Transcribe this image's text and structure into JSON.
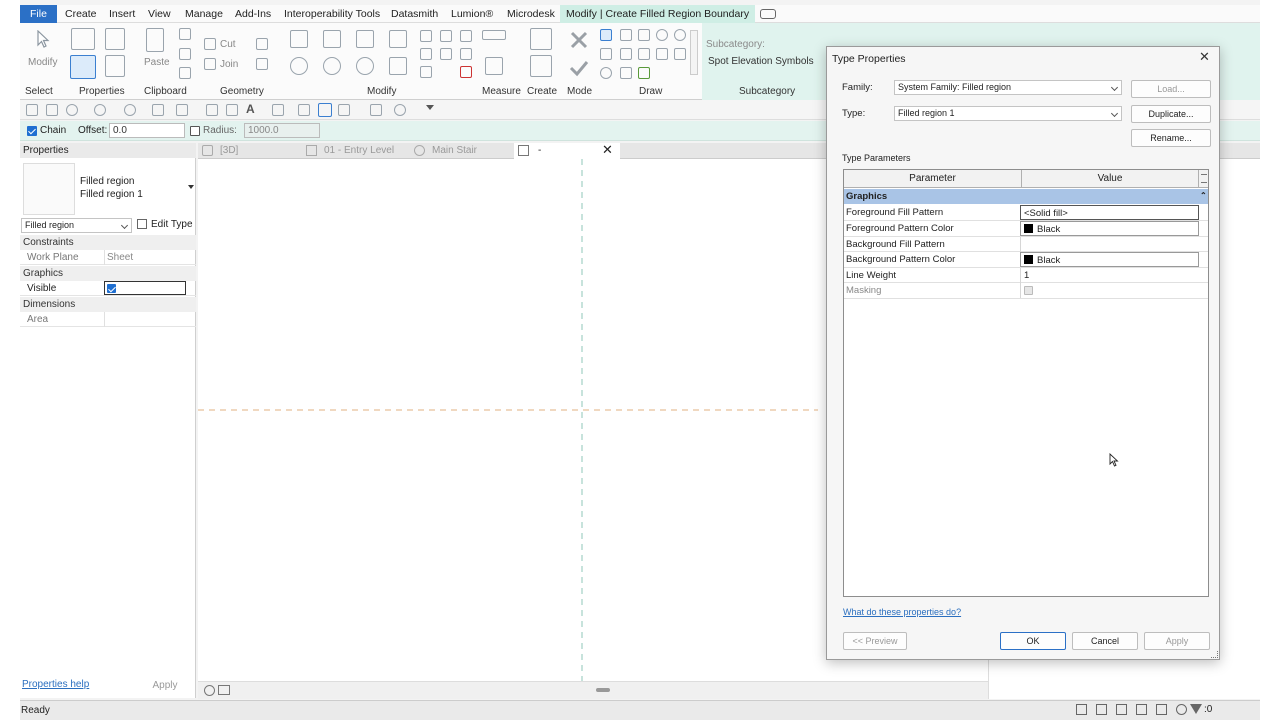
{
  "menu": {
    "tabs": [
      "File",
      "Create",
      "Insert",
      "View",
      "Manage",
      "Add-Ins",
      "Interoperability Tools",
      "Datasmith",
      "Lumion®",
      "Microdesk",
      "Modify | Create Filled Region Boundary"
    ]
  },
  "ribbon": {
    "modify_label": "Modify",
    "paste_label": "Paste",
    "cut_label": "Cut",
    "join_label": "Join",
    "subcategory_heading": "Subcategory:",
    "subcategory_value": "Spot Elevation Symbols",
    "panels": [
      "Select",
      "Properties",
      "Clipboard",
      "Geometry",
      "Modify",
      "Measure",
      "Create",
      "Mode",
      "Draw",
      "Subcategory"
    ]
  },
  "options_bar": {
    "chain_label": "Chain",
    "offset_label": "Offset:",
    "offset_value": "0.0",
    "radius_label": "Radius:",
    "radius_value": "1000.0"
  },
  "properties": {
    "title": "Properties",
    "type_line1": "Filled region",
    "type_line2": "Filled region 1",
    "selector": "Filled region",
    "edit_type": "Edit Type",
    "sections": {
      "constraints": "Constraints",
      "graphics": "Graphics",
      "dimensions": "Dimensions"
    },
    "rows": {
      "work_plane": {
        "name": "Work Plane",
        "value": "Sheet"
      },
      "visible": {
        "name": "Visible"
      },
      "area": {
        "name": "Area"
      }
    },
    "help_link": "Properties help",
    "apply_label": "Apply"
  },
  "view_tabs": [
    "[3D]",
    "01 - Entry Level",
    "Main Stair",
    "-"
  ],
  "status": {
    "text": "Ready",
    "selection_count": ":0"
  },
  "dialog": {
    "title": "Type Properties",
    "family_label": "Family:",
    "family_value": "System Family: Filled region",
    "type_label": "Type:",
    "type_value": "Filled region 1",
    "load_button": "Load...",
    "duplicate_button": "Duplicate...",
    "rename_button": "Rename...",
    "section_label": "Type Parameters",
    "col_parameter": "Parameter",
    "col_value": "Value",
    "group_name": "Graphics",
    "rows": [
      {
        "name": "Foreground Fill Pattern",
        "value": "<Solid fill>"
      },
      {
        "name": "Foreground Pattern Color",
        "value": "Black"
      },
      {
        "name": "Background Fill Pattern",
        "value": ""
      },
      {
        "name": "Background Pattern Color",
        "value": "Black"
      },
      {
        "name": "Line Weight",
        "value": "1"
      },
      {
        "name": "Masking",
        "value": ""
      }
    ],
    "help_link": "What do these properties do?",
    "preview_button": "<< Preview",
    "ok_button": "OK",
    "cancel_button": "Cancel",
    "apply_button": "Apply"
  },
  "colors": {
    "accent": "#2b70c6",
    "context_tab": "#cfeee5",
    "group_header": "#a9c4e6"
  }
}
